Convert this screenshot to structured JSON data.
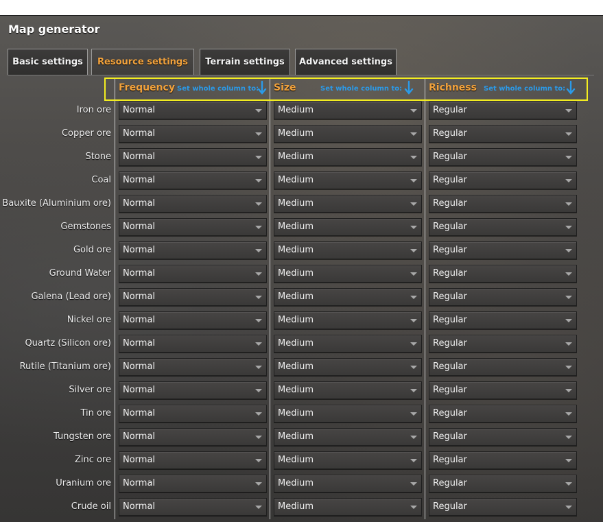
{
  "window": {
    "title": "Map generator"
  },
  "tabs": [
    {
      "label": "Basic settings",
      "active": false
    },
    {
      "label": "Resource settings",
      "active": true
    },
    {
      "label": "Terrain settings",
      "active": false
    },
    {
      "label": "Advanced settings",
      "active": false
    }
  ],
  "columns": [
    {
      "title": "Frequency",
      "set_label": "Set whole column to:"
    },
    {
      "title": "Size",
      "set_label": "Set whole column to:"
    },
    {
      "title": "Richness",
      "set_label": "Set whole column to:"
    }
  ],
  "rows": [
    {
      "label": "Iron ore",
      "frequency": "Normal",
      "size": "Medium",
      "richness": "Regular"
    },
    {
      "label": "Copper ore",
      "frequency": "Normal",
      "size": "Medium",
      "richness": "Regular"
    },
    {
      "label": "Stone",
      "frequency": "Normal",
      "size": "Medium",
      "richness": "Regular"
    },
    {
      "label": "Coal",
      "frequency": "Normal",
      "size": "Medium",
      "richness": "Regular"
    },
    {
      "label": "Bauxite (Aluminium ore)",
      "frequency": "Normal",
      "size": "Medium",
      "richness": "Regular"
    },
    {
      "label": "Gemstones",
      "frequency": "Normal",
      "size": "Medium",
      "richness": "Regular"
    },
    {
      "label": "Gold ore",
      "frequency": "Normal",
      "size": "Medium",
      "richness": "Regular"
    },
    {
      "label": "Ground Water",
      "frequency": "Normal",
      "size": "Medium",
      "richness": "Regular"
    },
    {
      "label": "Galena (Lead ore)",
      "frequency": "Normal",
      "size": "Medium",
      "richness": "Regular"
    },
    {
      "label": "Nickel ore",
      "frequency": "Normal",
      "size": "Medium",
      "richness": "Regular"
    },
    {
      "label": "Quartz (Silicon ore)",
      "frequency": "Normal",
      "size": "Medium",
      "richness": "Regular"
    },
    {
      "label": "Rutile (Titanium ore)",
      "frequency": "Normal",
      "size": "Medium",
      "richness": "Regular"
    },
    {
      "label": "Silver ore",
      "frequency": "Normal",
      "size": "Medium",
      "richness": "Regular"
    },
    {
      "label": "Tin ore",
      "frequency": "Normal",
      "size": "Medium",
      "richness": "Regular"
    },
    {
      "label": "Tungsten ore",
      "frequency": "Normal",
      "size": "Medium",
      "richness": "Regular"
    },
    {
      "label": "Zinc ore",
      "frequency": "Normal",
      "size": "Medium",
      "richness": "Regular"
    },
    {
      "label": "Uranium ore",
      "frequency": "Normal",
      "size": "Medium",
      "richness": "Regular"
    },
    {
      "label": "Crude oil",
      "frequency": "Normal",
      "size": "Medium",
      "richness": "Regular"
    }
  ],
  "icons": {
    "set_column": "down-arrow-icon",
    "dropdown": "chevron-down-icon"
  },
  "colors": {
    "accent": "#f2a23c",
    "link": "#2b9ae8",
    "highlight": "#f4ee20"
  }
}
